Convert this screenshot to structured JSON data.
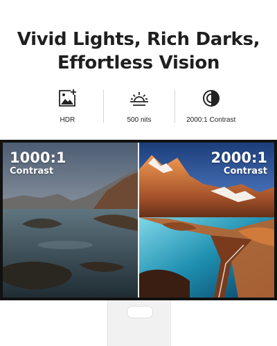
{
  "headline": {
    "line1": "Vivid Lights, Rich Darks,",
    "line2": "Effortless Vision"
  },
  "features": [
    {
      "label": "HDR",
      "icon": "hdr-image-icon"
    },
    {
      "label": "500 nits",
      "icon": "sunrise-brightness-icon"
    },
    {
      "label": "2000:1 Contrast",
      "icon": "contrast-icon"
    }
  ],
  "comparison": {
    "left": {
      "ratio": "1000:1",
      "caption": "Contrast"
    },
    "right": {
      "ratio": "2000:1",
      "caption": "Contrast"
    }
  }
}
